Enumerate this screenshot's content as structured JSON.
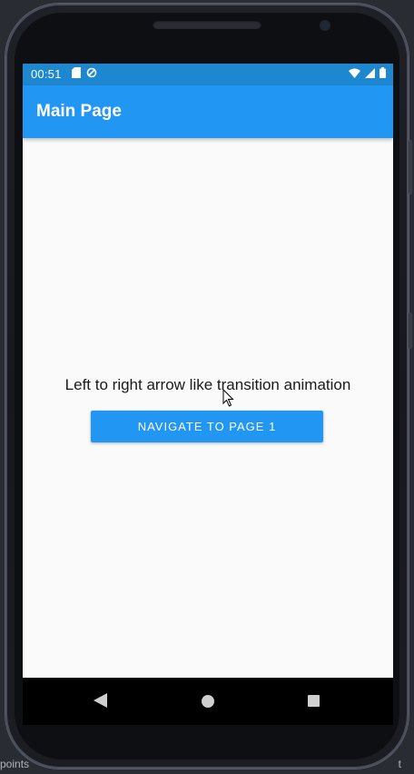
{
  "status_bar": {
    "time": "00:51",
    "left_icons": [
      "sd-card-icon",
      "sync-icon"
    ],
    "right_icons": [
      "wifi-icon",
      "signal-icon",
      "battery-icon"
    ]
  },
  "app_bar": {
    "title": "Main Page"
  },
  "content": {
    "message": "Left to right arrow like transition animation",
    "button_label": "NAVIGATE TO PAGE 1"
  },
  "nav_bar": {
    "buttons": [
      "back-icon",
      "home-icon",
      "recents-icon"
    ]
  },
  "ide": {
    "left_fragment": "points",
    "right_fragment": "t"
  },
  "colors": {
    "primary": "#2196f3",
    "status_bar": "#1d87d0",
    "background": "#fafafa"
  }
}
